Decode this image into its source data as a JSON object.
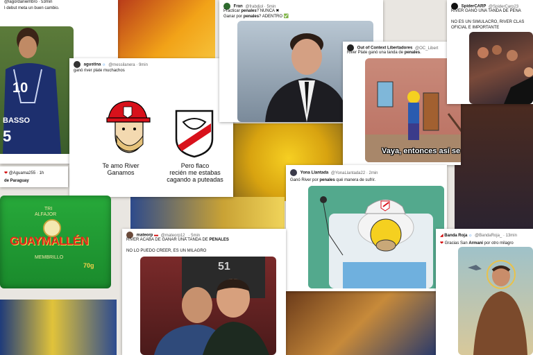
{
  "colors": {
    "river_red": "#d8111b",
    "guaymallen_green": "#1f9d34",
    "guaymallen_red": "#e22a1b",
    "gold": "#f2b705"
  },
  "tweets": {
    "t1": {
      "header": "@lagordaniembro · 53min",
      "text": "l·debut meta un buen cambio."
    },
    "t2": {
      "name": "agustina",
      "handle": "@messilanera · 9min",
      "text": "ganó river plate muchachos",
      "meme_left": "Te amo River\nGanamos",
      "meme_right": "Pero flaco\nrecién me estabas\ncagando a puteadas"
    },
    "t3": {
      "name": "Fran",
      "handle": "@frabdjol · 5min",
      "line1": "Practicar ",
      "line1_bold": "penales",
      "line1_rest": "? NUNCA ✖",
      "line2": "Ganar por ",
      "line2_bold": "penales",
      "line2_rest": "? ADENTRO ✅"
    },
    "t4": {
      "name": "Out of Context Libertadores",
      "handle": "@OC_Libert",
      "text_a": "River Plate ganó una tanda de ",
      "text_bold": "penales",
      "text_b": ".",
      "caption": "Vaya, entonces así se siente"
    },
    "t5": {
      "name": "SpiderCARP",
      "handle": "@SpiderCarp23",
      "text1": "RIVER GANÓ UNA TANDA DE PENA",
      "text2": "NO ES UN SIMULACRO, RIVER CLAS",
      "text3": "OFICIAL E IMPORTANTE"
    },
    "t6": {
      "handle": "@Aguama255 · 1h",
      "text": "de Paraguay"
    },
    "t7": {
      "name": "Yona Llantada",
      "handle": "@YonaLlantada22 · 2min",
      "text_a": "Ganó River por ",
      "text_bold": "penales",
      "text_b": " qué manera de sufrir."
    },
    "t8": {
      "name": "mateorp",
      "handle": "@mateorp12_ · 5min",
      "text_a": "RIVER ACABA DE GANAR UNA TANDA DE ",
      "text_bold": "PENALES",
      "text2": "NO LO PUEDO CREER, ES UN MILAGRO"
    },
    "t9": {
      "name": "Banda Roja",
      "handle": "@BandaRoja_ · 13min",
      "text_a": "Gracias San ",
      "text_bold": "Armani",
      "text_b": " por otro milagro"
    }
  },
  "product": {
    "top": "TRI",
    "brand_small": "ALFAJOR",
    "brand": "GUAYMALLÉN",
    "flavor": "MEMBRILLO",
    "weight": "70g"
  },
  "jersey": {
    "number": "10",
    "name": "BASSO",
    "number2": "5",
    "scoreboard": "51"
  },
  "shirt_logo": "CARP"
}
